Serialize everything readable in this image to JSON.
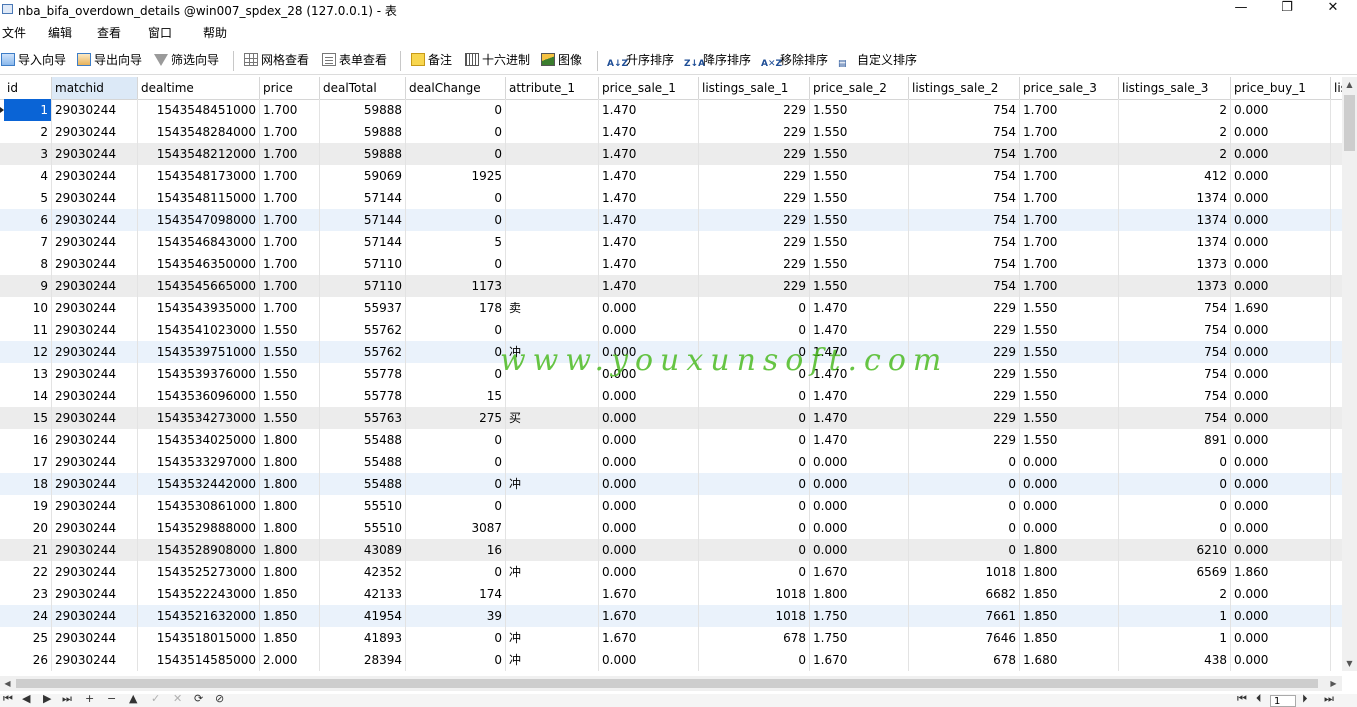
{
  "window": {
    "title": "nba_bifa_overdown_details @win007_spdex_28 (127.0.0.1) - 表",
    "minimize": "—",
    "maximize": "❐",
    "close": "✕"
  },
  "menu": [
    "文件",
    "编辑",
    "查看",
    "窗口",
    "帮助"
  ],
  "toolbar": {
    "import_wizard": "导入向导",
    "export_wizard": "导出向导",
    "filter_wizard": "筛选向导",
    "grid_view": "网格查看",
    "form_view": "表单查看",
    "memo": "备注",
    "hex": "十六进制",
    "image": "图像",
    "sort_asc": "升序排序",
    "sort_desc": "降序排序",
    "remove_sort": "移除排序",
    "custom_sort": "自定义排序",
    "sort_asc_glyph": "A↓Z",
    "sort_desc_glyph": "Z↓A",
    "remove_sort_glyph": "A✕Z",
    "custom_sort_glyph": "▤"
  },
  "columns": [
    "id",
    "matchid",
    "dealtime",
    "price",
    "dealTotal",
    "dealChange",
    "attribute_1",
    "price_sale_1",
    "listings_sale_1",
    "price_sale_2",
    "listings_sale_2",
    "price_sale_3",
    "listings_sale_3",
    "price_buy_1",
    "lis"
  ],
  "rows": [
    [
      "1",
      "29030244",
      "1543548451000",
      "1.700",
      "59888",
      "0",
      "",
      "1.470",
      "229",
      "1.550",
      "754",
      "1.700",
      "2",
      "0.000"
    ],
    [
      "2",
      "29030244",
      "1543548284000",
      "1.700",
      "59888",
      "0",
      "",
      "1.470",
      "229",
      "1.550",
      "754",
      "1.700",
      "2",
      "0.000"
    ],
    [
      "3",
      "29030244",
      "1543548212000",
      "1.700",
      "59888",
      "0",
      "",
      "1.470",
      "229",
      "1.550",
      "754",
      "1.700",
      "2",
      "0.000"
    ],
    [
      "4",
      "29030244",
      "1543548173000",
      "1.700",
      "59069",
      "1925",
      "",
      "1.470",
      "229",
      "1.550",
      "754",
      "1.700",
      "412",
      "0.000"
    ],
    [
      "5",
      "29030244",
      "1543548115000",
      "1.700",
      "57144",
      "0",
      "",
      "1.470",
      "229",
      "1.550",
      "754",
      "1.700",
      "1374",
      "0.000"
    ],
    [
      "6",
      "29030244",
      "1543547098000",
      "1.700",
      "57144",
      "0",
      "",
      "1.470",
      "229",
      "1.550",
      "754",
      "1.700",
      "1374",
      "0.000"
    ],
    [
      "7",
      "29030244",
      "1543546843000",
      "1.700",
      "57144",
      "5",
      "",
      "1.470",
      "229",
      "1.550",
      "754",
      "1.700",
      "1374",
      "0.000"
    ],
    [
      "8",
      "29030244",
      "1543546350000",
      "1.700",
      "57110",
      "0",
      "",
      "1.470",
      "229",
      "1.550",
      "754",
      "1.700",
      "1373",
      "0.000"
    ],
    [
      "9",
      "29030244",
      "1543545665000",
      "1.700",
      "57110",
      "1173",
      "",
      "1.470",
      "229",
      "1.550",
      "754",
      "1.700",
      "1373",
      "0.000"
    ],
    [
      "10",
      "29030244",
      "1543543935000",
      "1.700",
      "55937",
      "178",
      "卖",
      "0.000",
      "0",
      "1.470",
      "229",
      "1.550",
      "754",
      "1.690"
    ],
    [
      "11",
      "29030244",
      "1543541023000",
      "1.550",
      "55762",
      "0",
      "",
      "0.000",
      "0",
      "1.470",
      "229",
      "1.550",
      "754",
      "0.000"
    ],
    [
      "12",
      "29030244",
      "1543539751000",
      "1.550",
      "55762",
      "0",
      "冲",
      "0.000",
      "0",
      "1.470",
      "229",
      "1.550",
      "754",
      "0.000"
    ],
    [
      "13",
      "29030244",
      "1543539376000",
      "1.550",
      "55778",
      "0",
      "",
      "0.000",
      "0",
      "1.470",
      "229",
      "1.550",
      "754",
      "0.000"
    ],
    [
      "14",
      "29030244",
      "1543536096000",
      "1.550",
      "55778",
      "15",
      "",
      "0.000",
      "0",
      "1.470",
      "229",
      "1.550",
      "754",
      "0.000"
    ],
    [
      "15",
      "29030244",
      "1543534273000",
      "1.550",
      "55763",
      "275",
      "买",
      "0.000",
      "0",
      "1.470",
      "229",
      "1.550",
      "754",
      "0.000"
    ],
    [
      "16",
      "29030244",
      "1543534025000",
      "1.800",
      "55488",
      "0",
      "",
      "0.000",
      "0",
      "1.470",
      "229",
      "1.550",
      "891",
      "0.000"
    ],
    [
      "17",
      "29030244",
      "1543533297000",
      "1.800",
      "55488",
      "0",
      "",
      "0.000",
      "0",
      "0.000",
      "0",
      "0.000",
      "0",
      "0.000"
    ],
    [
      "18",
      "29030244",
      "1543532442000",
      "1.800",
      "55488",
      "0",
      "冲",
      "0.000",
      "0",
      "0.000",
      "0",
      "0.000",
      "0",
      "0.000"
    ],
    [
      "19",
      "29030244",
      "1543530861000",
      "1.800",
      "55510",
      "0",
      "",
      "0.000",
      "0",
      "0.000",
      "0",
      "0.000",
      "0",
      "0.000"
    ],
    [
      "20",
      "29030244",
      "1543529888000",
      "1.800",
      "55510",
      "3087",
      "",
      "0.000",
      "0",
      "0.000",
      "0",
      "0.000",
      "0",
      "0.000"
    ],
    [
      "21",
      "29030244",
      "1543528908000",
      "1.800",
      "43089",
      "16",
      "",
      "0.000",
      "0",
      "0.000",
      "0",
      "1.800",
      "6210",
      "0.000"
    ],
    [
      "22",
      "29030244",
      "1543525273000",
      "1.800",
      "42352",
      "0",
      "冲",
      "0.000",
      "0",
      "1.670",
      "1018",
      "1.800",
      "6569",
      "1.860"
    ],
    [
      "23",
      "29030244",
      "1543522243000",
      "1.850",
      "42133",
      "174",
      "",
      "1.670",
      "1018",
      "1.800",
      "6682",
      "1.850",
      "2",
      "0.000"
    ],
    [
      "24",
      "29030244",
      "1543521632000",
      "1.850",
      "41954",
      "39",
      "",
      "1.670",
      "1018",
      "1.750",
      "7661",
      "1.850",
      "1",
      "0.000"
    ],
    [
      "25",
      "29030244",
      "1543518015000",
      "1.850",
      "41893",
      "0",
      "冲",
      "1.670",
      "678",
      "1.750",
      "7646",
      "1.850",
      "1",
      "0.000"
    ],
    [
      "26",
      "29030244",
      "1543514585000",
      "2.000",
      "28394",
      "0",
      "冲",
      "0.000",
      "0",
      "1.670",
      "678",
      "1.680",
      "438",
      "0.000"
    ]
  ],
  "watermark": "www.youxunsoft.com",
  "navigation": {
    "first": "⏮",
    "prev": "◀",
    "next": "▶",
    "last": "⏭",
    "add": "+",
    "delete": "−",
    "up": "▲",
    "apply": "✓",
    "cancel": "✕",
    "refresh": "⟳",
    "stop": "⊘",
    "page_first": "⏮",
    "page_prev": "⏴",
    "page_number": "1",
    "page_next": "⏵",
    "page_last": "⏭"
  },
  "scroll": {
    "up": "▲",
    "down": "▼",
    "left": "◀",
    "right": "▶"
  }
}
